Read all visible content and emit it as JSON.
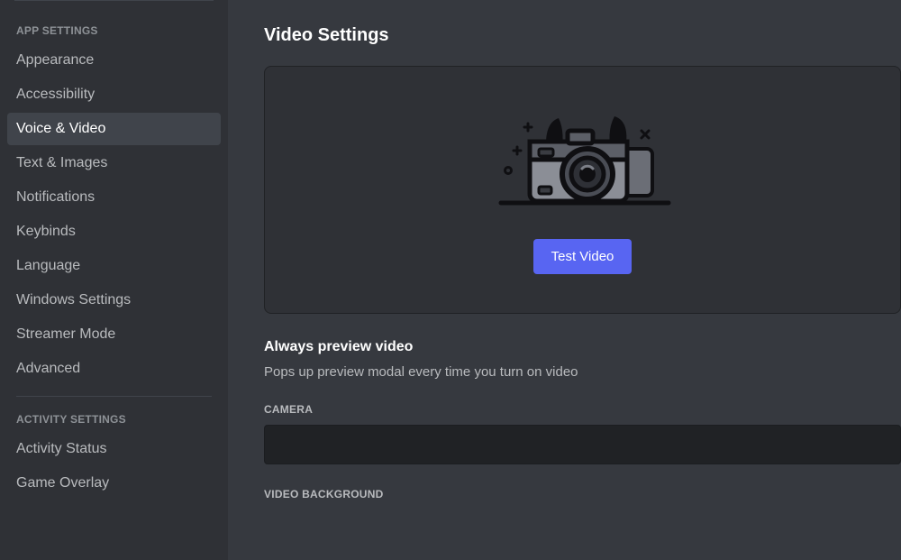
{
  "sidebar": {
    "headings": {
      "app": "APP SETTINGS",
      "activity": "ACTIVITY SETTINGS"
    },
    "appItems": [
      {
        "label": "Appearance"
      },
      {
        "label": "Accessibility"
      },
      {
        "label": "Voice & Video"
      },
      {
        "label": "Text & Images"
      },
      {
        "label": "Notifications"
      },
      {
        "label": "Keybinds"
      },
      {
        "label": "Language"
      },
      {
        "label": "Windows Settings"
      },
      {
        "label": "Streamer Mode"
      },
      {
        "label": "Advanced"
      }
    ],
    "activityItems": [
      {
        "label": "Activity Status"
      },
      {
        "label": "Game Overlay"
      }
    ],
    "activeIndex": 2
  },
  "main": {
    "title": "Video Settings",
    "testVideoLabel": "Test Video",
    "alwaysPreview": {
      "title": "Always preview video",
      "description": "Pops up preview modal every time you turn on video"
    },
    "cameraLabel": "CAMERA",
    "videoBackgroundLabel": "VIDEO BACKGROUND"
  }
}
